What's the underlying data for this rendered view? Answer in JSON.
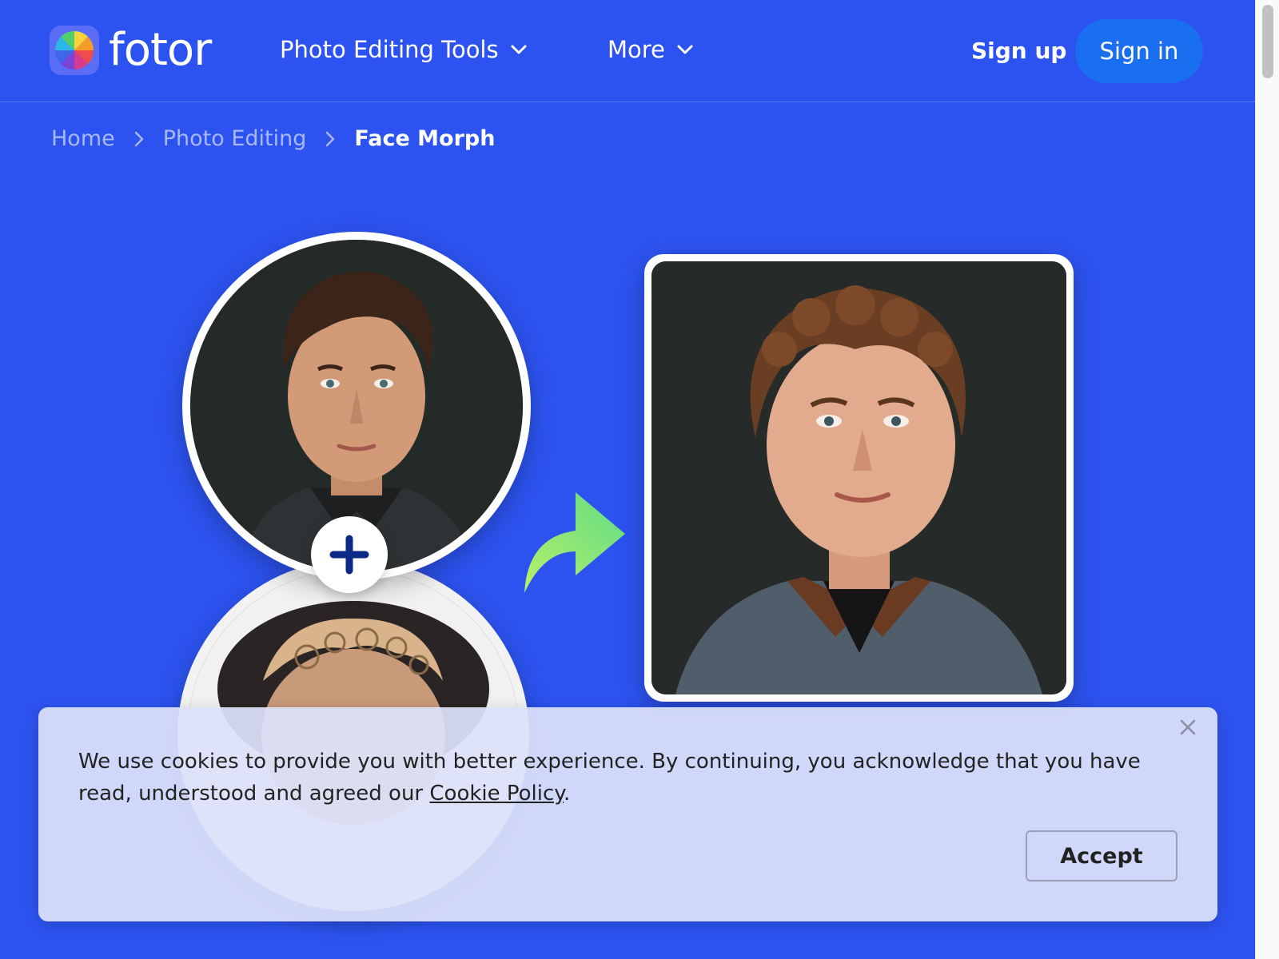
{
  "header": {
    "logo_text": "fotor",
    "nav": {
      "tools_label": "Photo Editing Tools",
      "more_label": "More"
    },
    "signup_label": "Sign up",
    "signin_label": "Sign in"
  },
  "breadcrumb": {
    "home": "Home",
    "section": "Photo Editing",
    "current": "Face Morph"
  },
  "hero": {
    "plus_icon": "plus-icon",
    "arrow_icon": "curved-arrow-icon",
    "arrow_color": "#7fe07a"
  },
  "cookie": {
    "text": "We use cookies to provide you with better experience. By continuing, you acknowledge that you have read, understood and agreed our ",
    "link": "Cookie Policy",
    "period": ".",
    "accept_label": "Accept"
  },
  "colors": {
    "background": "#2c53ef",
    "signin_bg": "#1a6ef0",
    "breadcrumb_inactive": "#a9b8fb"
  }
}
